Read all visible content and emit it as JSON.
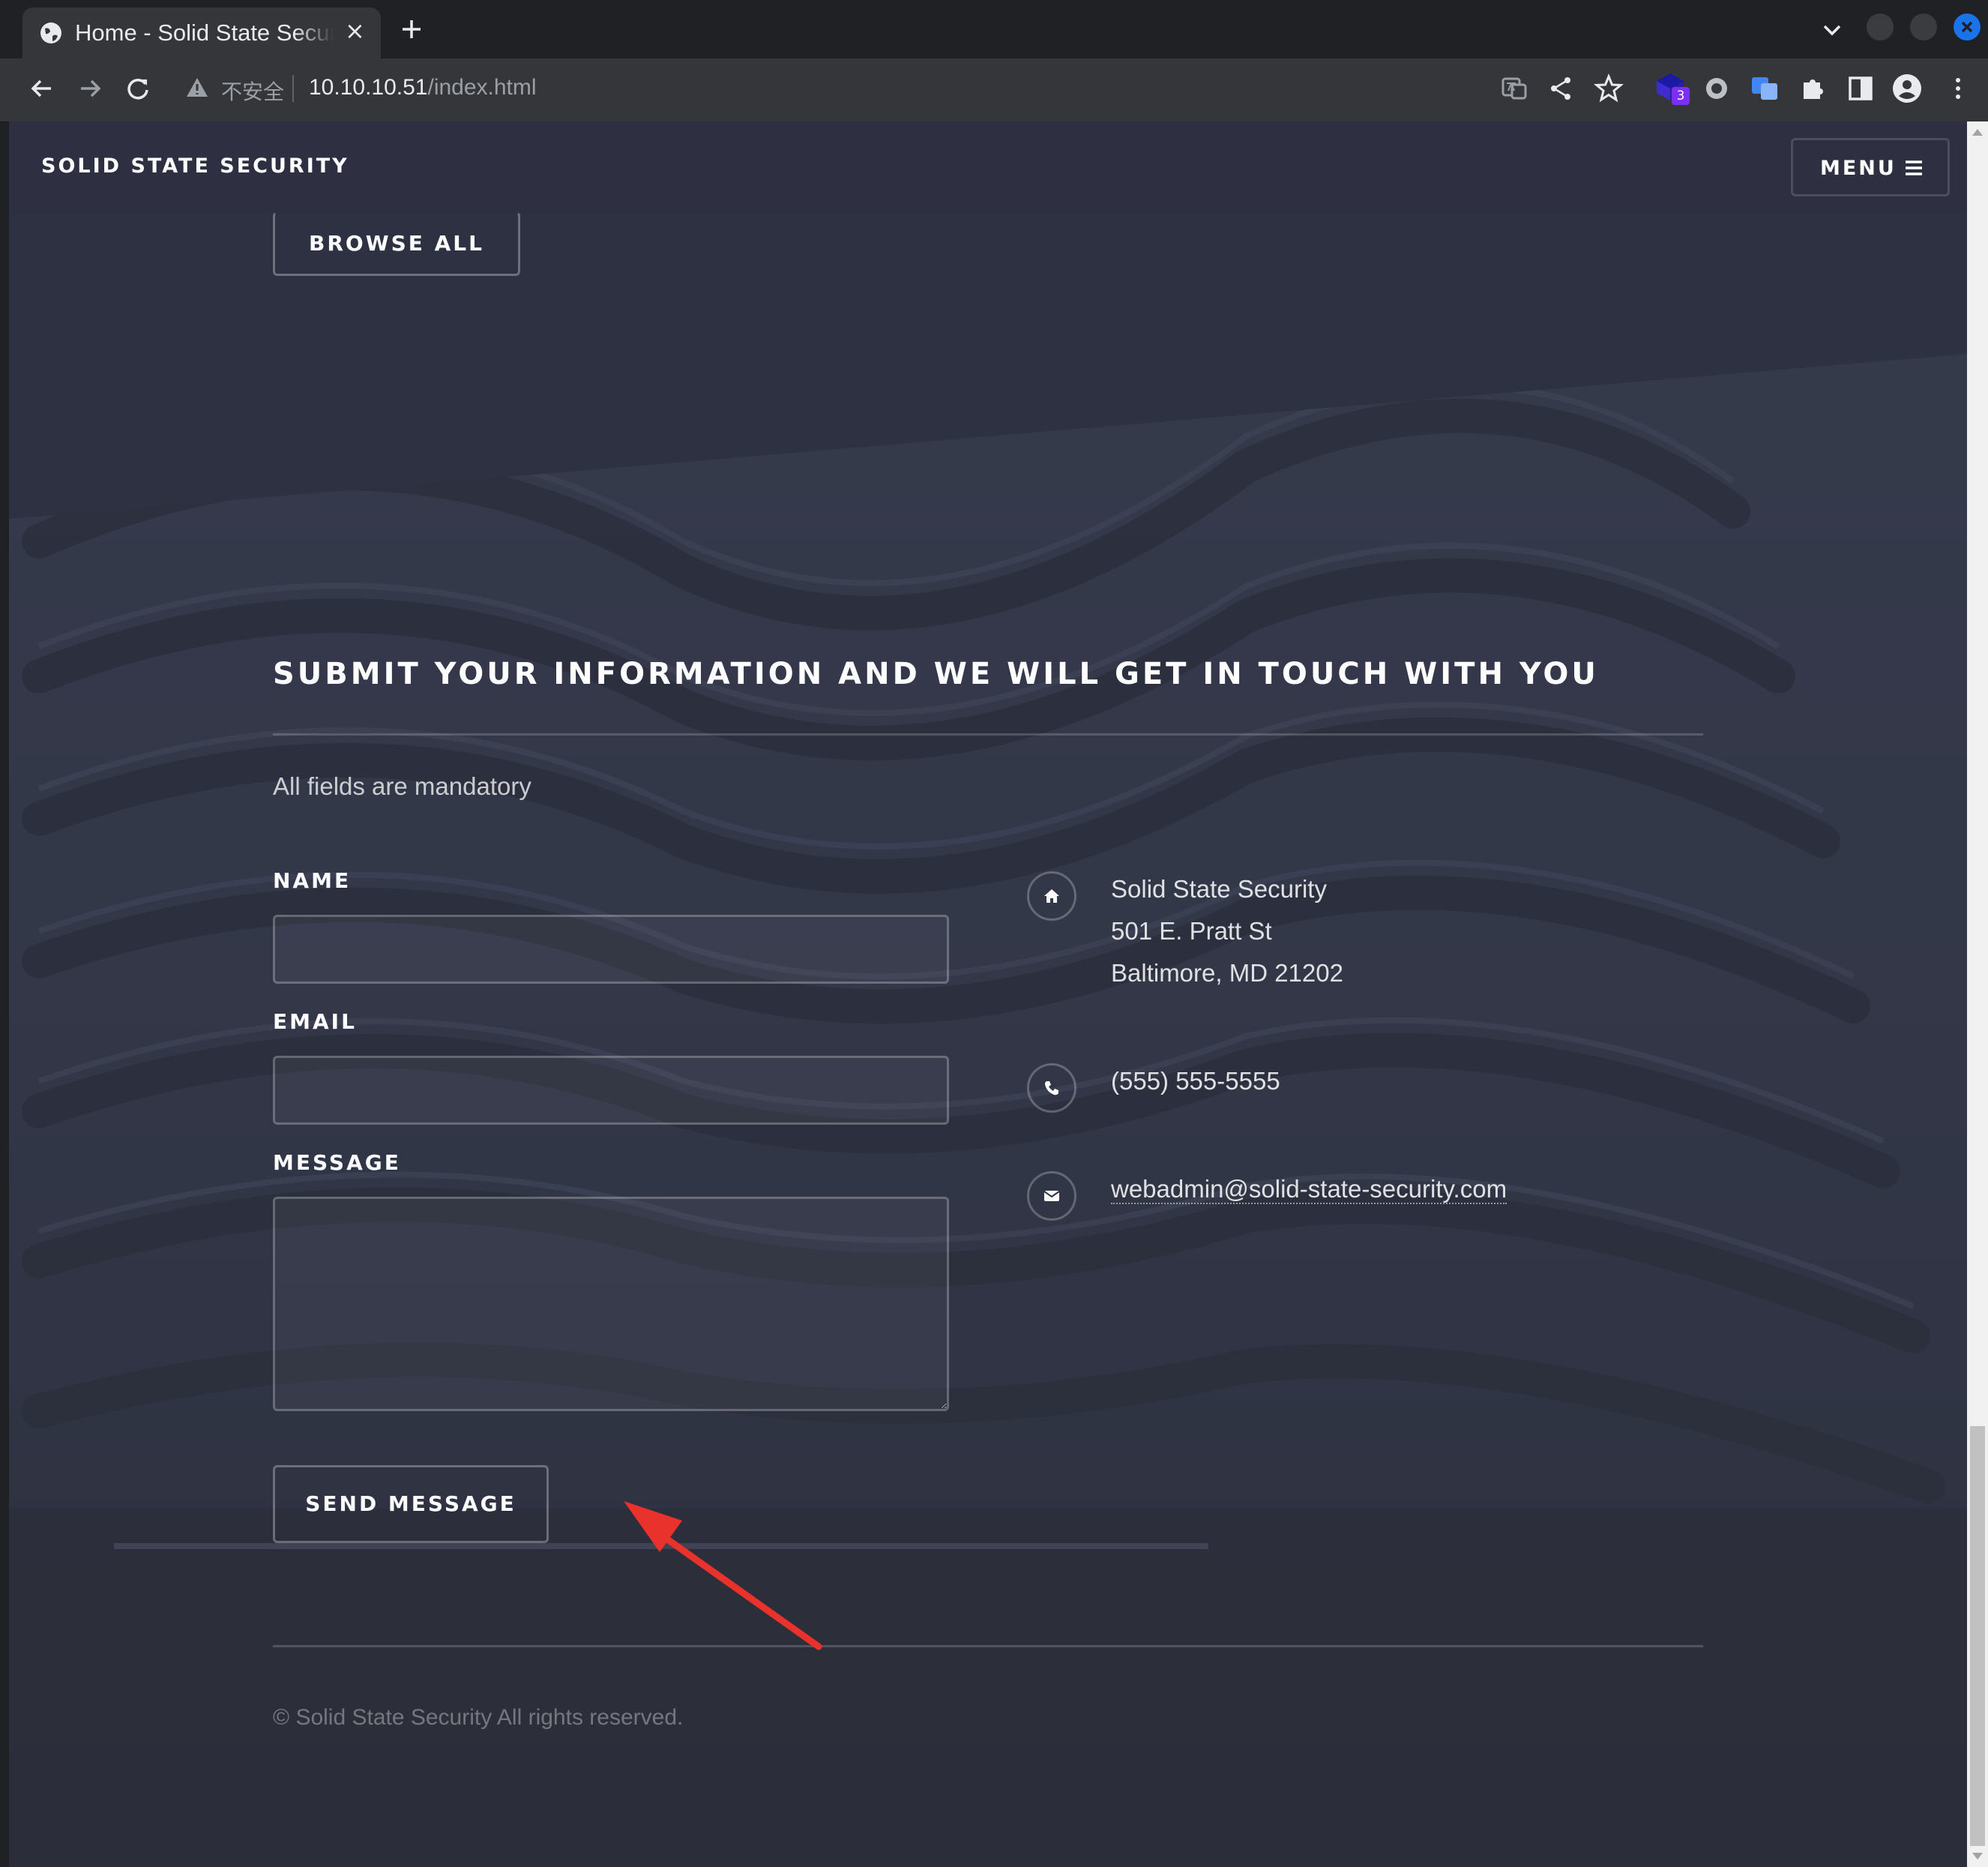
{
  "browser": {
    "tab_title": "Home - Solid State Security",
    "tab_close": "×",
    "security_label": "不安全",
    "url_host": "10.10.10.51",
    "url_path": "/index.html",
    "extension_badge": "3"
  },
  "header": {
    "brand": "SOLID STATE SECURITY",
    "menu_label": "MENU"
  },
  "browse_button": "BROWSE ALL",
  "form": {
    "heading": "SUBMIT YOUR INFORMATION AND WE WILL GET IN TOUCH WITH YOU",
    "subtitle": "All fields are mandatory",
    "name_label": "NAME",
    "email_label": "EMAIL",
    "message_label": "MESSAGE",
    "name_value": "",
    "email_value": "",
    "message_value": "",
    "send_label": "SEND MESSAGE"
  },
  "contact": {
    "address_line1": "Solid State Security",
    "address_line2": "501 E. Pratt St",
    "address_line3": "Baltimore, MD 21202",
    "phone": "(555) 555-5555",
    "email": "webadmin@solid-state-security.com"
  },
  "footer": {
    "copyright": "© Solid State Security All rights reserved."
  },
  "icons": {
    "address": "home-icon",
    "phone": "phone-icon",
    "email": "envelope-icon",
    "menu": "hamburger-icon"
  },
  "colors": {
    "page_bg": "#2e3141",
    "chrome_bg": "#202124",
    "toolbar_bg": "#35363a",
    "annotation_arrow": "#e8322b"
  }
}
